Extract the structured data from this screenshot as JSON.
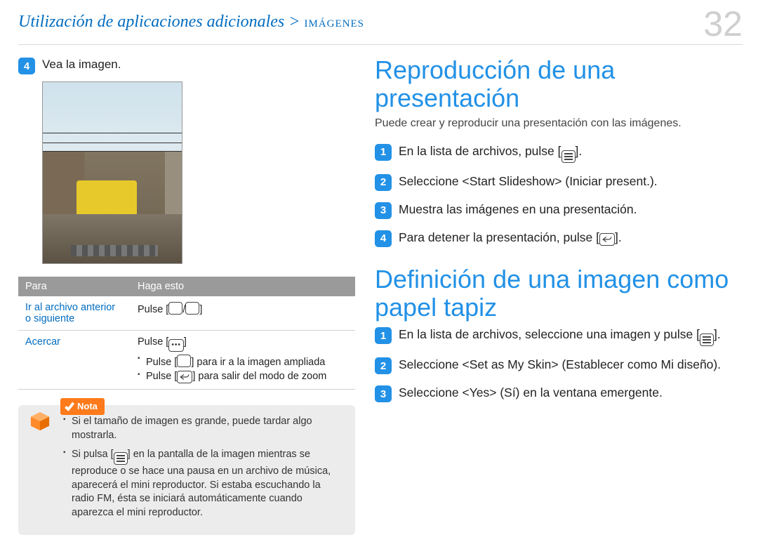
{
  "header": {
    "breadcrumb_main": "Utilización de aplicaciones adicionales >",
    "breadcrumb_tail": "imágenes",
    "page_number": "32"
  },
  "left": {
    "step4_num": "4",
    "step4_text": "Vea la imagen.",
    "table": {
      "head_para": "Para",
      "head_haga": "Haga esto",
      "row1_a": "Ir al archivo anterior o siguiente",
      "row1_b_pre": "Pulse [",
      "row1_b_mid": "/",
      "row1_b_post": "]",
      "row2_a": "Acercar",
      "row2_b_line1": "Pulse [",
      "row2_b_line1_post": "]",
      "row2_b_li1_pre": "Pulse [",
      "row2_b_li1_post": "] para ir a la imagen ampliada",
      "row2_b_li2_pre": "Pulse [",
      "row2_b_li2_post": "] para salir del modo de zoom"
    },
    "nota_label": "Nota",
    "nota_li1": "Si el tamaño de imagen es grande, puede tardar algo mostrarla.",
    "nota_li2_pre": "Si pulsa [",
    "nota_li2_post": "] en la pantalla de la imagen mientras se reproduce o se hace una pausa en un archivo de música, aparecerá el mini reproductor. Si estaba escuchando la radio FM, ésta se iniciará automáticamente cuando aparezca el mini reproductor."
  },
  "right": {
    "sec1_title": "Reproducción de una presentación",
    "sec1_intro": "Puede crear y reproducir una presentación con las imágenes.",
    "sec1": {
      "n1": "1",
      "t1_pre": "En la lista de archivos, pulse [",
      "t1_post": "].",
      "n2": "2",
      "t2": "Seleccione <Start Slideshow> (Iniciar present.).",
      "n3": "3",
      "t3": "Muestra las imágenes en una presentación.",
      "n4": "4",
      "t4_pre": "Para detener la presentación, pulse [",
      "t4_post": "]."
    },
    "sec2_title": "Definición de una imagen como papel tapiz",
    "sec2": {
      "n1": "1",
      "t1_pre": "En la lista de archivos, seleccione una imagen y pulse [",
      "t1_post": "].",
      "n2": "2",
      "t2": "Seleccione <Set as My Skin> (Establecer como Mi diseño).",
      "n3": "3",
      "t3": "Seleccione <Yes> (Sí) en la ventana emergente."
    }
  }
}
